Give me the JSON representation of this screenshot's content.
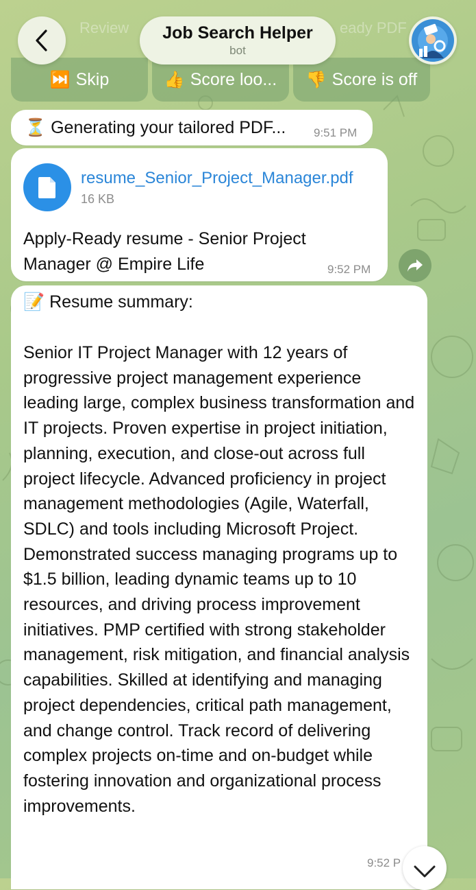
{
  "header": {
    "back_icon": "chevron-left-icon",
    "title": "Job Search Helper",
    "subtitle": "bot",
    "avatar_icon": "bot-avatar-icon"
  },
  "keyboard": {
    "buttons": [
      {
        "emoji": "⏭️",
        "label": "Skip"
      },
      {
        "emoji": "👍",
        "label": "Score loo..."
      },
      {
        "emoji": "👎",
        "label": "Score is off"
      }
    ]
  },
  "messages": {
    "generating": {
      "emoji": "⏳",
      "text": "Generating your tailored PDF...",
      "time": "9:51 PM"
    },
    "file": {
      "name": "resume_Senior_Project_Manager.pdf",
      "size": "16 KB",
      "caption": "Apply-Ready resume - Senior Project Manager @ Empire Life",
      "time": "9:52 PM"
    },
    "summary": {
      "emoji": "📝",
      "heading": "Resume summary:",
      "body": "Senior IT Project Manager with 12 years of progressive project management experience leading large, complex business transformation and IT projects. Proven expertise in project initiation, planning, execution, and close-out across full project lifecycle. Advanced proficiency in project management methodologies (Agile, Waterfall, SDLC) and tools including Microsoft Project. Demonstrated success managing programs up to $1.5 billion, leading dynamic teams up to 10 resources, and driving process improvement initiatives. PMP certified with strong stakeholder management, risk mitigation, and financial analysis capabilities. Skilled at identifying and managing project dependencies, critical path management, and change control. Track record of delivering complex projects on-time and on-budget while fostering innovation and organizational process improvements.",
      "time": "9:52 P"
    }
  },
  "colors": {
    "accent": "#2b90e6",
    "link": "#2b86d8",
    "bubble": "#ffffff"
  }
}
